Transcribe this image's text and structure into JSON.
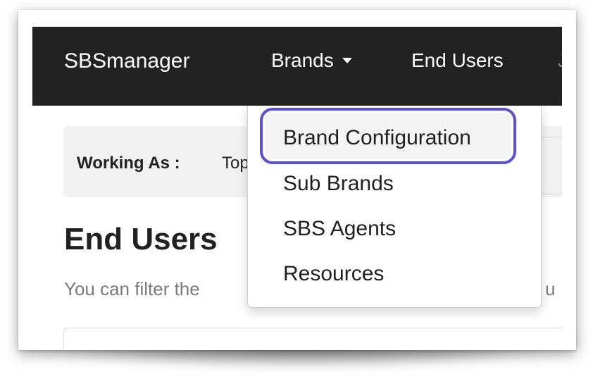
{
  "navbar": {
    "brand": "SBSmanager",
    "items": [
      {
        "label": "Brands",
        "has_dropdown": true
      },
      {
        "label": "End Users"
      },
      {
        "label": "J"
      }
    ]
  },
  "working_as": {
    "label": "Working As :",
    "value": "Top"
  },
  "page": {
    "title": "End Users",
    "description": "You can filter the",
    "description_tail": "u"
  },
  "brands_menu": {
    "items": [
      {
        "label": "Brand Configuration",
        "highlighted": true
      },
      {
        "label": "Sub Brands"
      },
      {
        "label": "SBS Agents"
      },
      {
        "label": "Resources"
      }
    ]
  },
  "colors": {
    "navbar_bg": "#212121",
    "highlight_ring": "#5a4fd8",
    "panel_bg": "#f2f2f2"
  }
}
